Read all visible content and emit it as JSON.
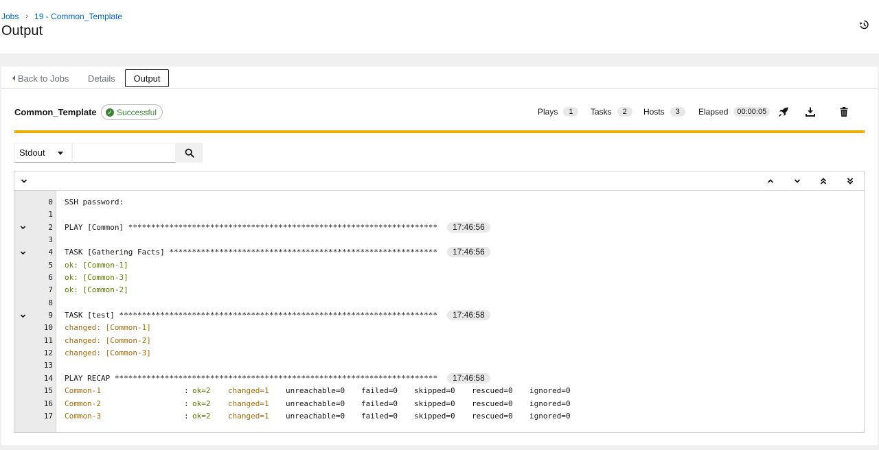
{
  "breadcrumb": {
    "root": "Jobs",
    "current": "19 - Common_Template"
  },
  "page_title": "Output",
  "tabs": {
    "back": "Back to Jobs",
    "details": "Details",
    "output": "Output"
  },
  "job": {
    "name": "Common_Template",
    "status": "Successful",
    "stats": {
      "plays_label": "Plays",
      "plays": "1",
      "tasks_label": "Tasks",
      "tasks": "2",
      "hosts_label": "Hosts",
      "hosts": "3",
      "elapsed_label": "Elapsed",
      "elapsed": "00:00:05"
    },
    "progress_fraction": 1.0,
    "progress_color": "#f0ab00"
  },
  "search": {
    "select_value": "Stdout",
    "query": ""
  },
  "output": {
    "lines": [
      {
        "n": "0",
        "text": "SSH password:",
        "kind": "plain",
        "toggle": false,
        "time": ""
      },
      {
        "n": "1",
        "text": "",
        "kind": "plain",
        "toggle": false,
        "time": ""
      },
      {
        "n": "2",
        "text": "PLAY [Common] ********************************************************************",
        "kind": "plain",
        "toggle": true,
        "time": "17:46:56"
      },
      {
        "n": "3",
        "text": "",
        "kind": "plain",
        "toggle": false,
        "time": ""
      },
      {
        "n": "4",
        "text": "TASK [Gathering Facts] ***********************************************************",
        "kind": "plain",
        "toggle": true,
        "time": "17:46:56"
      },
      {
        "n": "5",
        "text": "ok: [Common-1]",
        "kind": "ok",
        "toggle": false,
        "time": ""
      },
      {
        "n": "6",
        "text": "ok: [Common-3]",
        "kind": "ok",
        "toggle": false,
        "time": ""
      },
      {
        "n": "7",
        "text": "ok: [Common-2]",
        "kind": "ok",
        "toggle": false,
        "time": ""
      },
      {
        "n": "8",
        "text": "",
        "kind": "plain",
        "toggle": false,
        "time": ""
      },
      {
        "n": "9",
        "text": "TASK [test] **********************************************************************",
        "kind": "plain",
        "toggle": true,
        "time": "17:46:58"
      },
      {
        "n": "10",
        "text": "changed: [Common-1]",
        "kind": "changed",
        "toggle": false,
        "time": ""
      },
      {
        "n": "11",
        "text": "changed: [Common-2]",
        "kind": "changed",
        "toggle": false,
        "time": ""
      },
      {
        "n": "12",
        "text": "changed: [Common-3]",
        "kind": "changed",
        "toggle": false,
        "time": ""
      },
      {
        "n": "13",
        "text": "",
        "kind": "plain",
        "toggle": false,
        "time": ""
      },
      {
        "n": "14",
        "text": "PLAY RECAP ***********************************************************************",
        "kind": "plain",
        "toggle": false,
        "time": "17:46:58"
      }
    ],
    "recap": [
      {
        "n": "15",
        "host": "Common-1",
        "colon": ":",
        "ok": "ok=2",
        "changed": "changed=1",
        "unreachable": "unreachable=0",
        "failed": "failed=0",
        "skipped": "skipped=0",
        "rescued": "rescued=0",
        "ignored": "ignored=0"
      },
      {
        "n": "16",
        "host": "Common-2",
        "colon": ":",
        "ok": "ok=2",
        "changed": "changed=1",
        "unreachable": "unreachable=0",
        "failed": "failed=0",
        "skipped": "skipped=0",
        "rescued": "rescued=0",
        "ignored": "ignored=0"
      },
      {
        "n": "17",
        "host": "Common-3",
        "colon": ":",
        "ok": "ok=2",
        "changed": "changed=1",
        "unreachable": "unreachable=0",
        "failed": "failed=0",
        "skipped": "skipped=0",
        "rescued": "rescued=0",
        "ignored": "ignored=0"
      }
    ]
  },
  "icons": {
    "history": "history-icon",
    "launch": "rocket-icon",
    "download": "download-icon",
    "delete": "trash-icon",
    "search": "search-icon"
  }
}
